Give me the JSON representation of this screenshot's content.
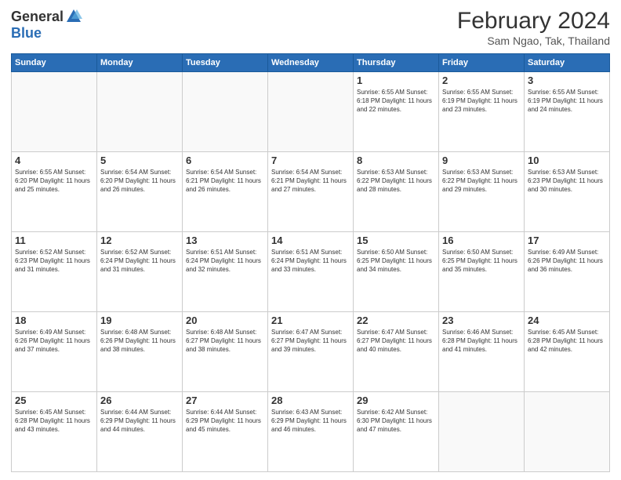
{
  "header": {
    "logo_general": "General",
    "logo_blue": "Blue",
    "main_title": "February 2024",
    "subtitle": "Sam Ngao, Tak, Thailand"
  },
  "days_of_week": [
    "Sunday",
    "Monday",
    "Tuesday",
    "Wednesday",
    "Thursday",
    "Friday",
    "Saturday"
  ],
  "weeks": [
    [
      {
        "day": "",
        "info": ""
      },
      {
        "day": "",
        "info": ""
      },
      {
        "day": "",
        "info": ""
      },
      {
        "day": "",
        "info": ""
      },
      {
        "day": "1",
        "info": "Sunrise: 6:55 AM\nSunset: 6:18 PM\nDaylight: 11 hours and 22 minutes."
      },
      {
        "day": "2",
        "info": "Sunrise: 6:55 AM\nSunset: 6:19 PM\nDaylight: 11 hours and 23 minutes."
      },
      {
        "day": "3",
        "info": "Sunrise: 6:55 AM\nSunset: 6:19 PM\nDaylight: 11 hours and 24 minutes."
      }
    ],
    [
      {
        "day": "4",
        "info": "Sunrise: 6:55 AM\nSunset: 6:20 PM\nDaylight: 11 hours and 25 minutes."
      },
      {
        "day": "5",
        "info": "Sunrise: 6:54 AM\nSunset: 6:20 PM\nDaylight: 11 hours and 26 minutes."
      },
      {
        "day": "6",
        "info": "Sunrise: 6:54 AM\nSunset: 6:21 PM\nDaylight: 11 hours and 26 minutes."
      },
      {
        "day": "7",
        "info": "Sunrise: 6:54 AM\nSunset: 6:21 PM\nDaylight: 11 hours and 27 minutes."
      },
      {
        "day": "8",
        "info": "Sunrise: 6:53 AM\nSunset: 6:22 PM\nDaylight: 11 hours and 28 minutes."
      },
      {
        "day": "9",
        "info": "Sunrise: 6:53 AM\nSunset: 6:22 PM\nDaylight: 11 hours and 29 minutes."
      },
      {
        "day": "10",
        "info": "Sunrise: 6:53 AM\nSunset: 6:23 PM\nDaylight: 11 hours and 30 minutes."
      }
    ],
    [
      {
        "day": "11",
        "info": "Sunrise: 6:52 AM\nSunset: 6:23 PM\nDaylight: 11 hours and 31 minutes."
      },
      {
        "day": "12",
        "info": "Sunrise: 6:52 AM\nSunset: 6:24 PM\nDaylight: 11 hours and 31 minutes."
      },
      {
        "day": "13",
        "info": "Sunrise: 6:51 AM\nSunset: 6:24 PM\nDaylight: 11 hours and 32 minutes."
      },
      {
        "day": "14",
        "info": "Sunrise: 6:51 AM\nSunset: 6:24 PM\nDaylight: 11 hours and 33 minutes."
      },
      {
        "day": "15",
        "info": "Sunrise: 6:50 AM\nSunset: 6:25 PM\nDaylight: 11 hours and 34 minutes."
      },
      {
        "day": "16",
        "info": "Sunrise: 6:50 AM\nSunset: 6:25 PM\nDaylight: 11 hours and 35 minutes."
      },
      {
        "day": "17",
        "info": "Sunrise: 6:49 AM\nSunset: 6:26 PM\nDaylight: 11 hours and 36 minutes."
      }
    ],
    [
      {
        "day": "18",
        "info": "Sunrise: 6:49 AM\nSunset: 6:26 PM\nDaylight: 11 hours and 37 minutes."
      },
      {
        "day": "19",
        "info": "Sunrise: 6:48 AM\nSunset: 6:26 PM\nDaylight: 11 hours and 38 minutes."
      },
      {
        "day": "20",
        "info": "Sunrise: 6:48 AM\nSunset: 6:27 PM\nDaylight: 11 hours and 38 minutes."
      },
      {
        "day": "21",
        "info": "Sunrise: 6:47 AM\nSunset: 6:27 PM\nDaylight: 11 hours and 39 minutes."
      },
      {
        "day": "22",
        "info": "Sunrise: 6:47 AM\nSunset: 6:27 PM\nDaylight: 11 hours and 40 minutes."
      },
      {
        "day": "23",
        "info": "Sunrise: 6:46 AM\nSunset: 6:28 PM\nDaylight: 11 hours and 41 minutes."
      },
      {
        "day": "24",
        "info": "Sunrise: 6:45 AM\nSunset: 6:28 PM\nDaylight: 11 hours and 42 minutes."
      }
    ],
    [
      {
        "day": "25",
        "info": "Sunrise: 6:45 AM\nSunset: 6:28 PM\nDaylight: 11 hours and 43 minutes."
      },
      {
        "day": "26",
        "info": "Sunrise: 6:44 AM\nSunset: 6:29 PM\nDaylight: 11 hours and 44 minutes."
      },
      {
        "day": "27",
        "info": "Sunrise: 6:44 AM\nSunset: 6:29 PM\nDaylight: 11 hours and 45 minutes."
      },
      {
        "day": "28",
        "info": "Sunrise: 6:43 AM\nSunset: 6:29 PM\nDaylight: 11 hours and 46 minutes."
      },
      {
        "day": "29",
        "info": "Sunrise: 6:42 AM\nSunset: 6:30 PM\nDaylight: 11 hours and 47 minutes."
      },
      {
        "day": "",
        "info": ""
      },
      {
        "day": "",
        "info": ""
      }
    ]
  ]
}
